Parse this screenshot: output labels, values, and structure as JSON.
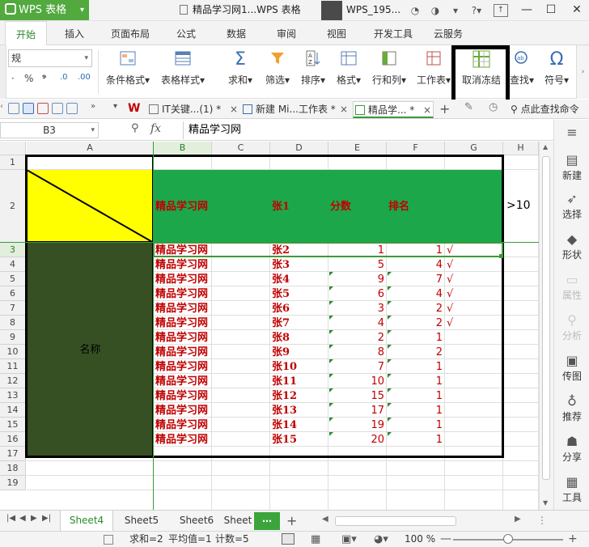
{
  "app": {
    "menu_label": "WPS 表格",
    "document_title": "精品学习网1...WPS 表格",
    "user_name": "WPS_195...",
    "window_controls": [
      "minimize",
      "maximize",
      "close"
    ]
  },
  "ribbon": {
    "tabs": [
      "开始",
      "插入",
      "页面布局",
      "公式",
      "数据",
      "审阅",
      "视图",
      "开发工具",
      "云服务"
    ],
    "active_tab": "开始"
  },
  "toolbar": {
    "number_format": "规",
    "format_symbols": [
      "%",
      "⁹",
      ".0",
      ".00"
    ],
    "buttons": [
      {
        "label": "条件格式",
        "icon": "conditional-format-icon"
      },
      {
        "label": "表格样式",
        "icon": "table-style-icon"
      },
      {
        "label": "求和",
        "icon": "sum-icon",
        "glyph": "Σ"
      },
      {
        "label": "筛选",
        "icon": "filter-icon"
      },
      {
        "label": "排序",
        "icon": "sort-icon"
      },
      {
        "label": "格式",
        "icon": "format-icon"
      },
      {
        "label": "行和列",
        "icon": "rows-cols-icon"
      },
      {
        "label": "工作表",
        "icon": "worksheet-icon"
      },
      {
        "label": "取消冻结",
        "icon": "unfreeze-icon"
      },
      {
        "label": "查找",
        "icon": "find-icon"
      },
      {
        "label": "符号",
        "icon": "symbol-icon",
        "glyph": "Ω"
      }
    ],
    "highlighted_button": "取消冻结"
  },
  "doc_tabs": {
    "tabs": [
      {
        "label": "IT关键...(1) *",
        "active": false
      },
      {
        "label": "新建 Mi...工作表 *",
        "active": false
      },
      {
        "label": "精品学... *",
        "active": true
      }
    ],
    "help_search_label": "点此查找命令"
  },
  "formula_bar": {
    "cell_ref": "B3",
    "fx_label": "fx",
    "content": "精品学习网"
  },
  "sheet": {
    "columns": [
      "A",
      "B",
      "C",
      "D",
      "E",
      "F",
      "G",
      "H"
    ],
    "selected_column": "B",
    "selected_row": 3,
    "rows": [
      1,
      2,
      3,
      4,
      5,
      6,
      7,
      8,
      9,
      10,
      11,
      12,
      13,
      14,
      15,
      16,
      17,
      18,
      19
    ],
    "header_row": {
      "b": "精品学习网",
      "d": "张1",
      "e": "分数",
      "f": "排名",
      "h": ">10"
    },
    "merged_a_label": "名称",
    "data": [
      {
        "b": "精品学习网",
        "d": "张2",
        "e": "1",
        "f": "1",
        "g": "√"
      },
      {
        "b": "精品学习网",
        "d": "张3",
        "e": "5",
        "f": "4",
        "g": "√"
      },
      {
        "b": "精品学习网",
        "d": "张4",
        "e": "9",
        "f": "7",
        "g": "√"
      },
      {
        "b": "精品学习网",
        "d": "张5",
        "e": "6",
        "f": "4",
        "g": "√"
      },
      {
        "b": "精品学习网",
        "d": "张6",
        "e": "3",
        "f": "2",
        "g": "√"
      },
      {
        "b": "精品学习网",
        "d": "张7",
        "e": "4",
        "f": "2",
        "g": "√"
      },
      {
        "b": "精品学习网",
        "d": "张8",
        "e": "2",
        "f": "1",
        "g": ""
      },
      {
        "b": "精品学习网",
        "d": "张9",
        "e": "8",
        "f": "2",
        "g": ""
      },
      {
        "b": "精品学习网",
        "d": "张10",
        "e": "7",
        "f": "1",
        "g": ""
      },
      {
        "b": "精品学习网",
        "d": "张11",
        "e": "10",
        "f": "1",
        "g": ""
      },
      {
        "b": "精品学习网",
        "d": "张12",
        "e": "15",
        "f": "1",
        "g": ""
      },
      {
        "b": "精品学习网",
        "d": "张13",
        "e": "17",
        "f": "1",
        "g": ""
      },
      {
        "b": "精品学习网",
        "d": "张14",
        "e": "19",
        "f": "1",
        "g": ""
      },
      {
        "b": "精品学习网",
        "d": "张15",
        "e": "20",
        "f": "1",
        "g": ""
      }
    ],
    "colors": {
      "header_green": "#1ca84a",
      "a_yellow": "#ffff00",
      "a_dark": "#375023",
      "text_red": "#c00000",
      "accent": "#2b8a2b"
    }
  },
  "right_panel": {
    "items": [
      {
        "label": "新建",
        "enabled": true
      },
      {
        "label": "选择",
        "enabled": true
      },
      {
        "label": "形状",
        "enabled": true
      },
      {
        "label": "属性",
        "enabled": false
      },
      {
        "label": "分析",
        "enabled": false
      },
      {
        "label": "传图",
        "enabled": true
      },
      {
        "label": "推荐",
        "enabled": true
      },
      {
        "label": "分享",
        "enabled": true
      },
      {
        "label": "工具",
        "enabled": true
      }
    ]
  },
  "sheet_tabs": {
    "tabs": [
      "Sheet4",
      "Sheet5",
      "Sheet6",
      "Sheet"
    ],
    "active": "Sheet4",
    "more_label": "⋯",
    "add_label": "+"
  },
  "status_bar": {
    "sum": "求和=2",
    "average": "平均值=1",
    "count": "计数=5",
    "zoom": "100 %",
    "zoom_level": 1.0
  }
}
